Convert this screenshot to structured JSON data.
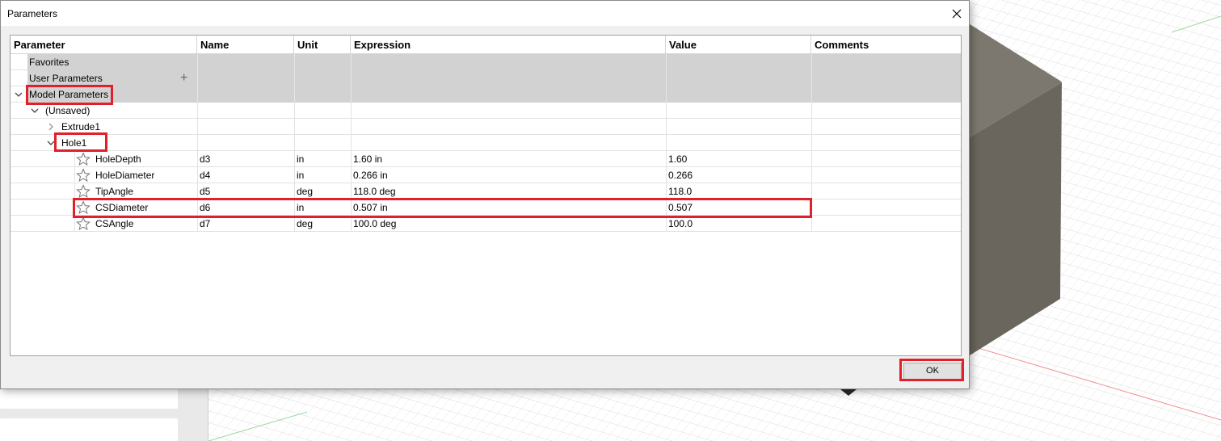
{
  "dialog": {
    "title": "Parameters",
    "ok_label": "OK"
  },
  "columns": [
    "Parameter",
    "Name",
    "Unit",
    "Expression",
    "Value",
    "Comments"
  ],
  "groups": {
    "favorites": "Favorites",
    "user_parameters": "User Parameters",
    "model_parameters": "Model Parameters",
    "unsaved": "(Unsaved)",
    "extrude": "Extrude1",
    "hole": "Hole1"
  },
  "params": [
    {
      "parameter": "HoleDepth",
      "name": "d3",
      "unit": "in",
      "expression": "1.60 in",
      "value": "1.60",
      "comments": ""
    },
    {
      "parameter": "HoleDiameter",
      "name": "d4",
      "unit": "in",
      "expression": "0.266 in",
      "value": "0.266",
      "comments": ""
    },
    {
      "parameter": "TipAngle",
      "name": "d5",
      "unit": "deg",
      "expression": "118.0 deg",
      "value": "118.0",
      "comments": ""
    },
    {
      "parameter": "CSDiameter",
      "name": "d6",
      "unit": "in",
      "expression": "0.507 in",
      "value": "0.507",
      "comments": ""
    },
    {
      "parameter": "CSAngle",
      "name": "d7",
      "unit": "deg",
      "expression": "100.0 deg",
      "value": "100.0",
      "comments": ""
    }
  ],
  "icons": {
    "close": "close-icon",
    "add": "plus-icon",
    "expand": "chevron-down-icon",
    "collapse": "chevron-right-icon",
    "favorite": "star-outline-icon"
  },
  "colors": {
    "highlight": "#e0202a",
    "group_row": "#d2d2d2"
  }
}
